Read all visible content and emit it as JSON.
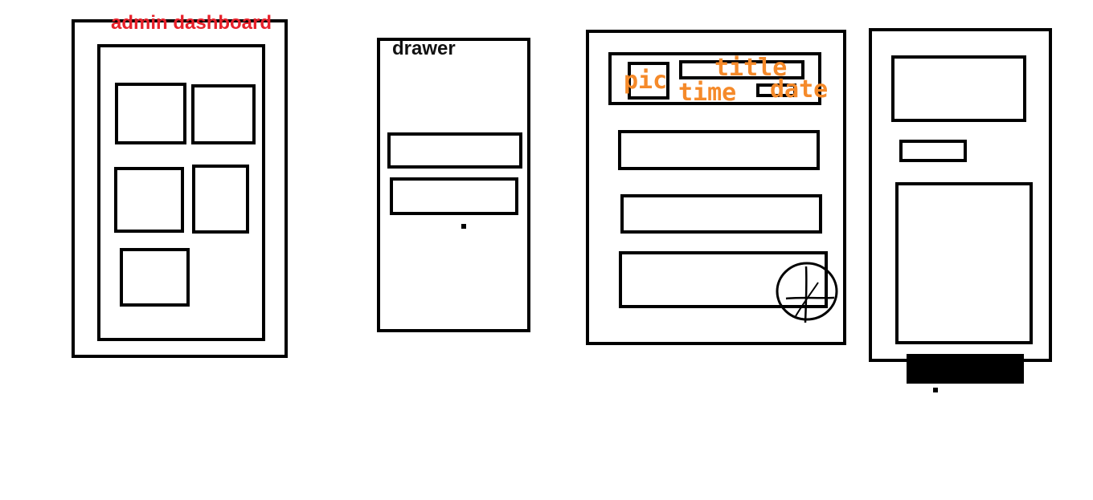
{
  "sketch_1": {
    "label": "admin dashboard"
  },
  "sketch_2": {
    "label": "drawer"
  },
  "sketch_3": {
    "labels": {
      "pic": "pic",
      "title": "title",
      "time": "time",
      "date": "date"
    }
  },
  "colors": {
    "stroke": "#000000",
    "red_label": "#e8202a",
    "orange_label": "#f58a2a"
  },
  "icons": {
    "add_button": "circled-plus-icon"
  }
}
